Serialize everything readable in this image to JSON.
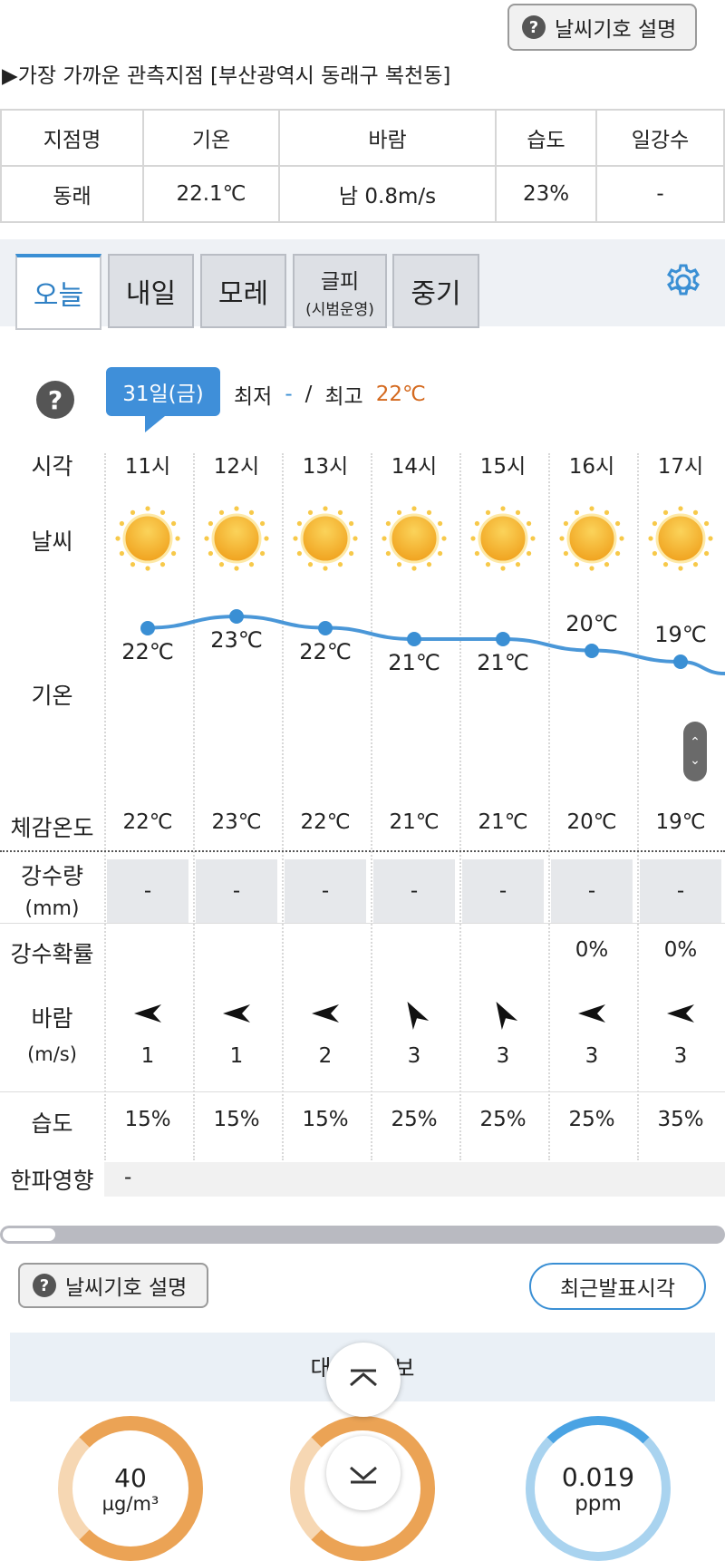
{
  "top": {
    "help_button": "날씨기호 설명",
    "station_line": "▶가장 가까운 관측지점 [부산광역시 동래구 복천동]"
  },
  "obs_table": {
    "headers": [
      "지점명",
      "기온",
      "바람",
      "습도",
      "일강수"
    ],
    "values": [
      "동래",
      "22.1℃",
      "남 0.8m/s",
      "23%",
      "-"
    ]
  },
  "tabs": [
    {
      "label": "오늘"
    },
    {
      "label": "내일"
    },
    {
      "label": "모레"
    },
    {
      "label": "글피",
      "sub": "(시범운영)"
    },
    {
      "label": "중기"
    }
  ],
  "forecast": {
    "date_badge": "31일(금)",
    "min_label": "최저",
    "min_value": "-",
    "slash": "/",
    "max_label": "최고",
    "max_value": "22℃",
    "row_labels": {
      "time": "시각",
      "weather": "날씨",
      "temp": "기온",
      "feels": "체감온도",
      "precip": "강수량",
      "precip_unit": "(mm)",
      "prob": "강수확률",
      "wind": "바람",
      "wind_unit": "(m/s)",
      "humidity": "습도",
      "cold": "한파영향"
    },
    "hours": [
      "11시",
      "12시",
      "13시",
      "14시",
      "15시",
      "16시",
      "17시"
    ],
    "temps": [
      "22℃",
      "23℃",
      "22℃",
      "21℃",
      "21℃",
      "20℃",
      "19℃"
    ],
    "feels": [
      "22℃",
      "23℃",
      "22℃",
      "21℃",
      "21℃",
      "20℃",
      "19℃"
    ],
    "precip": [
      "-",
      "-",
      "-",
      "-",
      "-",
      "-",
      "-"
    ],
    "prob": [
      "",
      "",
      "",
      "",
      "",
      "0%",
      "0%"
    ],
    "wind_speed": [
      "1",
      "1",
      "2",
      "3",
      "3",
      "3",
      "3"
    ],
    "humidity": [
      "15%",
      "15%",
      "15%",
      "25%",
      "25%",
      "25%",
      "35%"
    ],
    "cold_impact": "-",
    "weather_icon": "sun-icon"
  },
  "bottom": {
    "help_button": "날씨기호 설명",
    "recent_button": "최근발표시각",
    "air_banner": "대기질정보",
    "air1_value": "40",
    "air1_unit": "µg/m³",
    "air3_value": "0.019",
    "air3_unit": "ppm"
  },
  "colors": {
    "accent_blue": "#3a8fd4",
    "temp_max": "#d4691e",
    "air_orange": "#eba355",
    "air_blue": "#a9d3ef"
  }
}
